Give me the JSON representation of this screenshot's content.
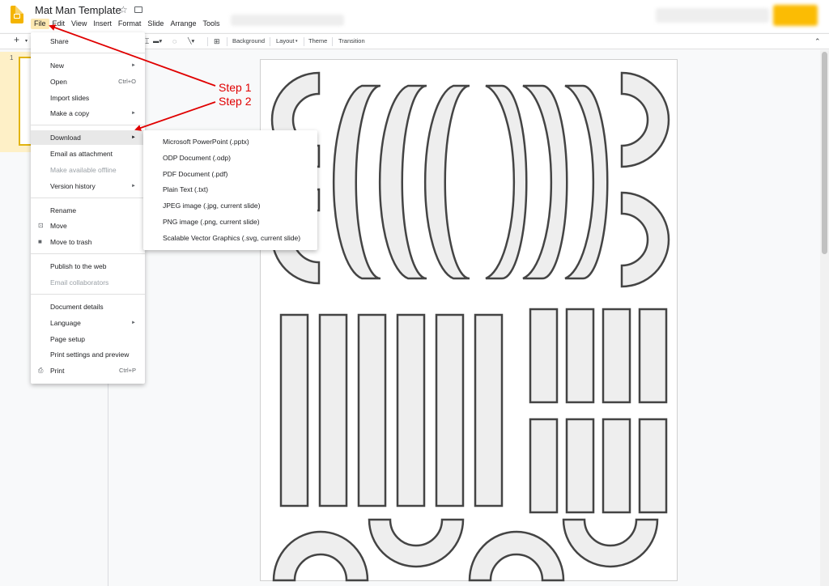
{
  "header": {
    "doc_title": "Mat Man Template",
    "menus": [
      "File",
      "Edit",
      "View",
      "Insert",
      "Format",
      "Slide",
      "Arrange",
      "Tools"
    ],
    "active_menu": "File"
  },
  "toolbar": {
    "add_label": "+",
    "background_label": "Background",
    "layout_label": "Layout",
    "theme_label": "Theme",
    "transition_label": "Transition"
  },
  "filmstrip": {
    "slide_number": "1"
  },
  "file_menu": {
    "items": [
      {
        "label": "Share"
      },
      {
        "label": "New"
      },
      {
        "label": "Open",
        "shortcut": "Ctrl+O"
      },
      {
        "label": "Import slides"
      },
      {
        "label": "Make a copy"
      },
      {
        "label": "Download"
      },
      {
        "label": "Email as attachment"
      },
      {
        "label": "Make available offline"
      },
      {
        "label": "Version history"
      },
      {
        "label": "Rename"
      },
      {
        "label": "Move"
      },
      {
        "label": "Move to trash"
      },
      {
        "label": "Publish to the web"
      },
      {
        "label": "Email collaborators"
      },
      {
        "label": "Document details"
      },
      {
        "label": "Language"
      },
      {
        "label": "Page setup"
      },
      {
        "label": "Print settings and preview"
      },
      {
        "label": "Print",
        "shortcut": "Ctrl+P"
      }
    ]
  },
  "download_submenu": {
    "items": [
      "Microsoft PowerPoint (.pptx)",
      "ODP Document (.odp)",
      "PDF Document (.pdf)",
      "Plain Text (.txt)",
      "JPEG image (.jpg, current slide)",
      "PNG image (.png, current slide)",
      "Scalable Vector Graphics (.svg, current slide)"
    ]
  },
  "annotations": {
    "step1": "Step 1",
    "step2": "Step 2",
    "color": "#e00000"
  },
  "colors": {
    "accent": "#f4b400",
    "menu_highlight": "#fce8b2",
    "shape_fill": "#eeeeee",
    "shape_stroke": "#444444"
  }
}
